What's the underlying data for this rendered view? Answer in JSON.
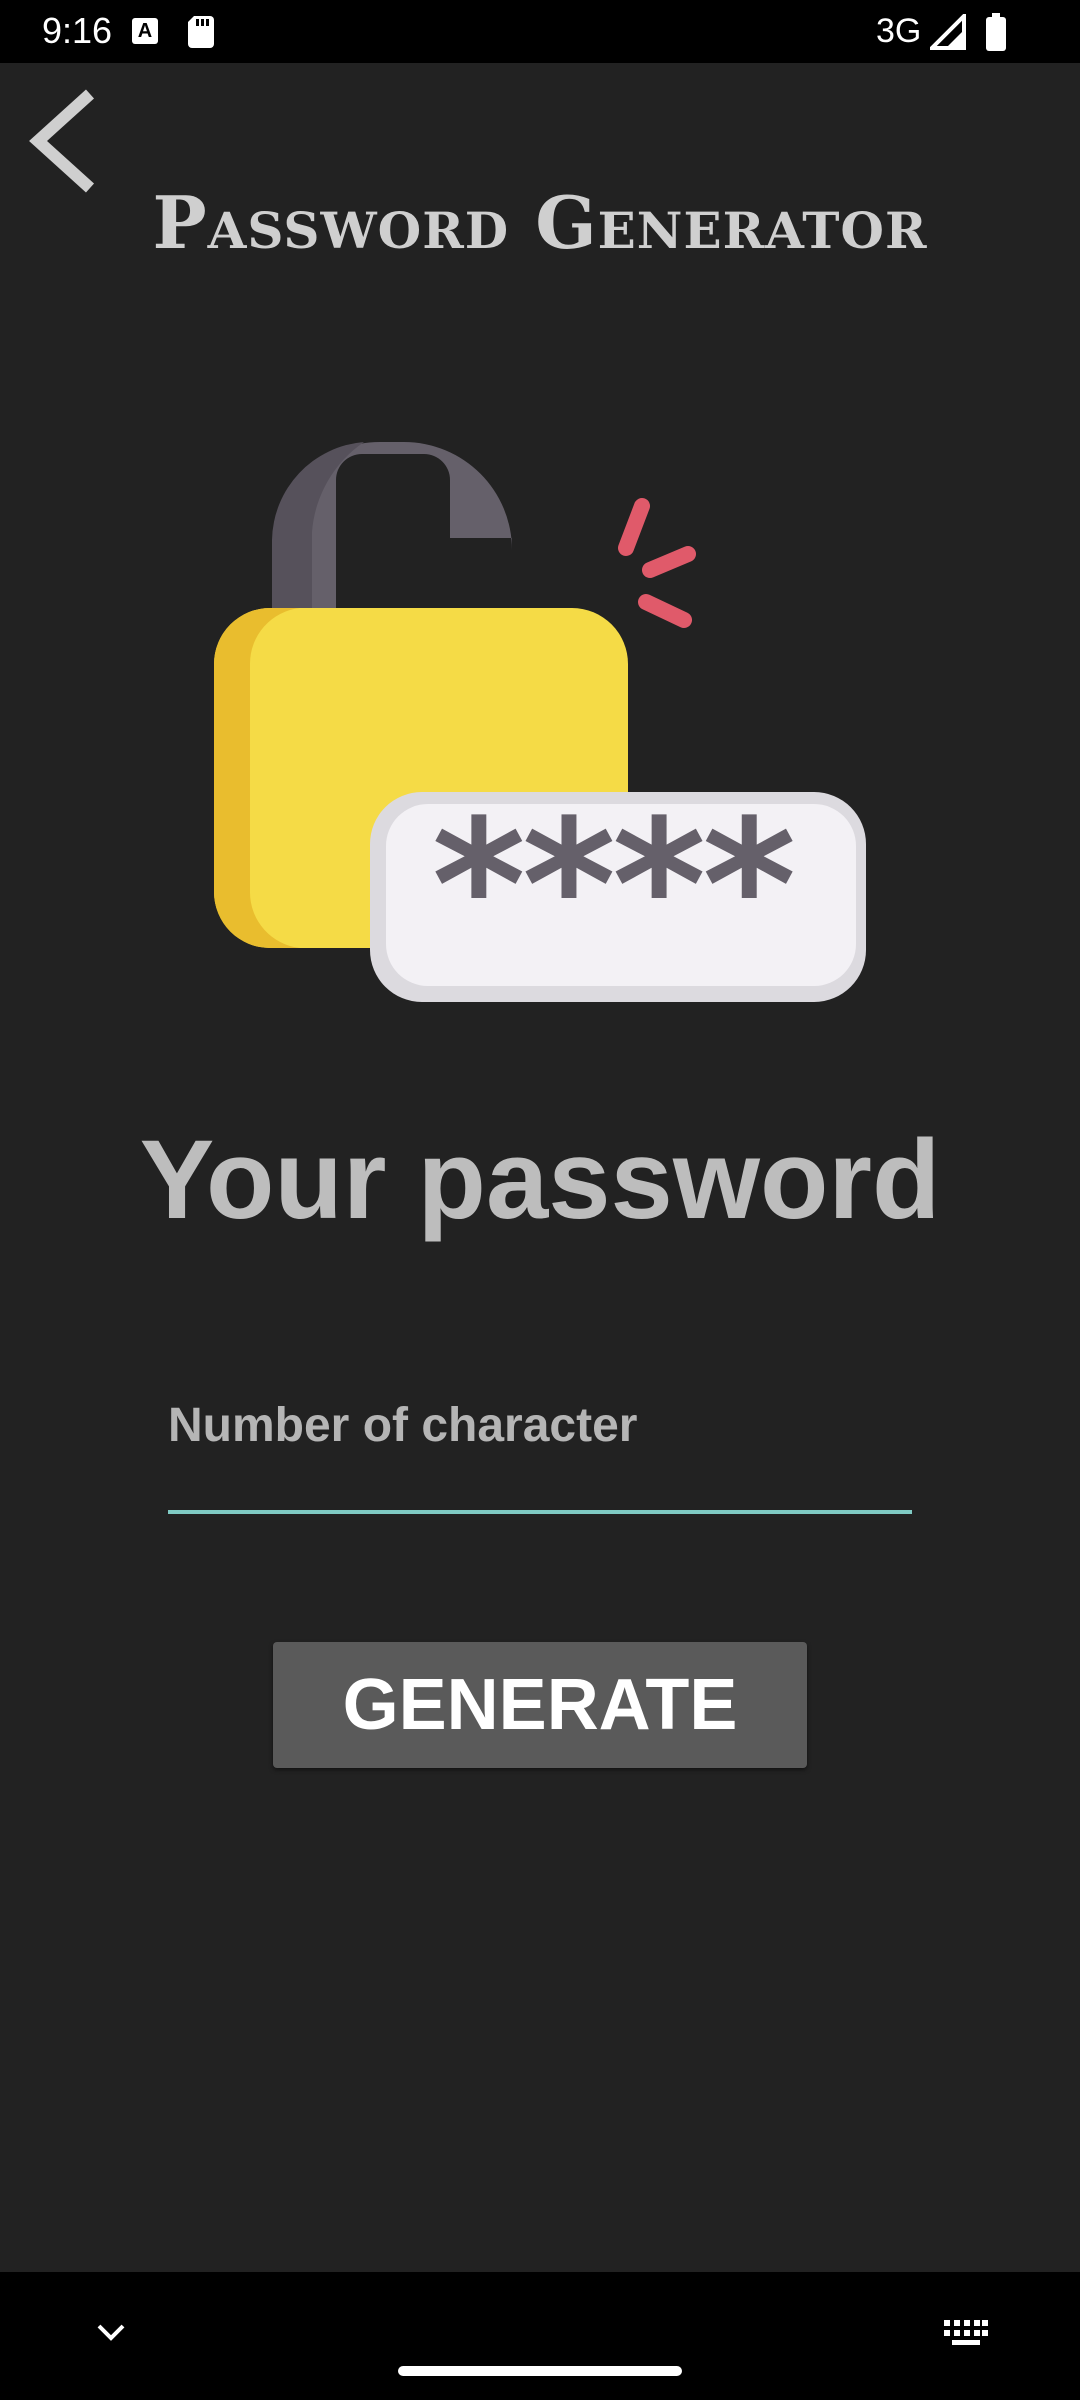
{
  "status_bar": {
    "time": "9:16",
    "network": "3G",
    "notification_icon_letter": "A",
    "icons": [
      "sim-card-icon",
      "signal-icon",
      "battery-icon"
    ]
  },
  "header": {
    "back_icon": "chevron-left-icon",
    "title": "Password Generator"
  },
  "hero": {
    "icon": "padlock-password-icon",
    "masked_text": "****",
    "colors": {
      "lock_body": "#F5DB46",
      "shackle": "#65606A",
      "accent": "#E05A6A"
    }
  },
  "main": {
    "password_label": "Your password",
    "length_input": {
      "placeholder": "Number of character",
      "value": ""
    },
    "generate_label": "GENERATE"
  },
  "nav_bar": {
    "icons": [
      "chevron-down-icon",
      "home-handle",
      "keyboard-icon"
    ]
  },
  "colors": {
    "background": "#222222",
    "button": "#5A5A5A",
    "input_underline": "#80CBC4",
    "heading_text": "#BDBDBD"
  }
}
